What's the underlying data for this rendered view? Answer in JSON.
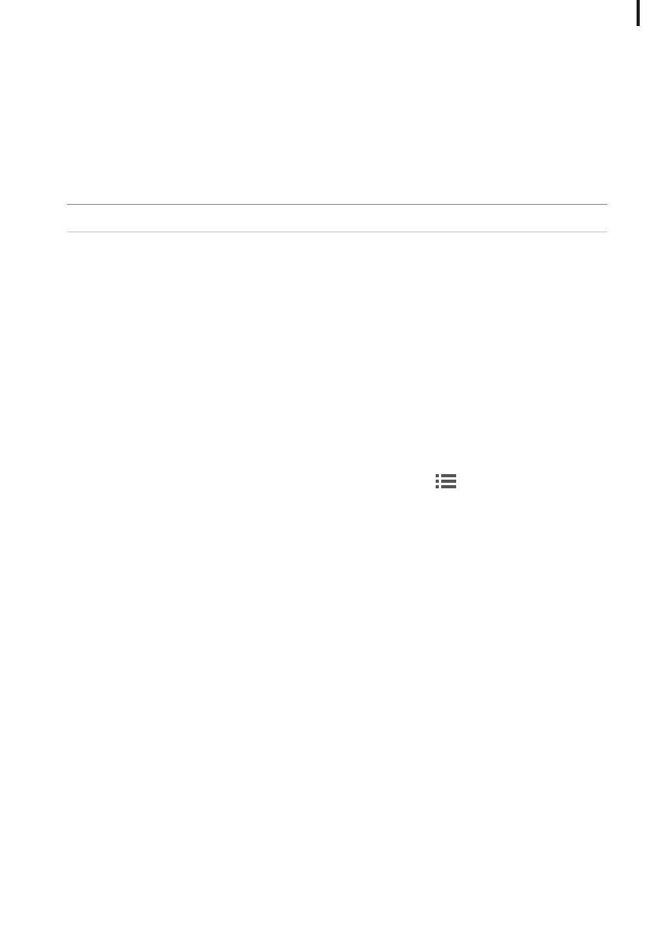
{
  "icons": {
    "list_view": "list-icon"
  },
  "colors": {
    "icon": "#555555",
    "rule_top": "#8a8a8a",
    "rule_bottom": "#c8c8c8",
    "edge_marker": "#1a1a1a",
    "background": "#ffffff"
  }
}
